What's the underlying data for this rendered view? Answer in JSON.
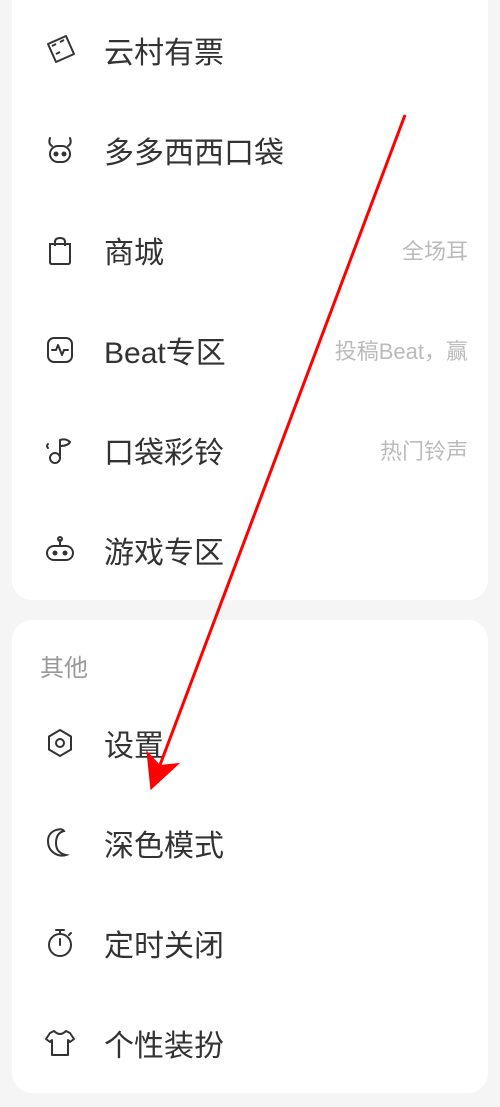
{
  "section1": {
    "items": [
      {
        "label": "云村有票",
        "hint": ""
      },
      {
        "label": "多多西西口袋",
        "hint": ""
      },
      {
        "label": "商城",
        "hint": "全场耳"
      },
      {
        "label": "Beat专区",
        "hint": "投稿Beat，赢"
      },
      {
        "label": "口袋彩铃",
        "hint": "热门铃声"
      },
      {
        "label": "游戏专区",
        "hint": ""
      }
    ]
  },
  "section2": {
    "header": "其他",
    "items": [
      {
        "label": "设置",
        "hint": ""
      },
      {
        "label": "深色模式",
        "hint": ""
      },
      {
        "label": "定时关闭",
        "hint": ""
      },
      {
        "label": "个性装扮",
        "hint": ""
      }
    ]
  },
  "annotation": {
    "color": "#ff0000"
  }
}
